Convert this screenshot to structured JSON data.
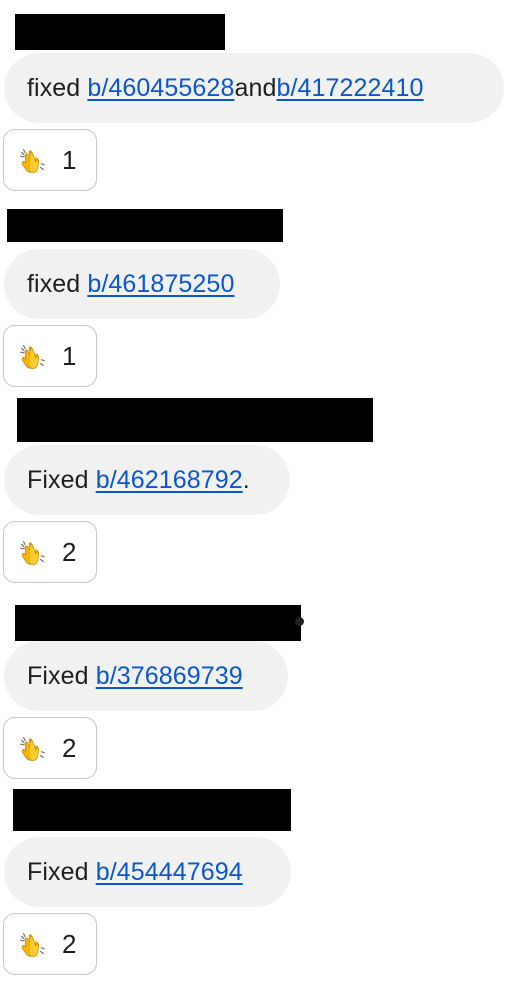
{
  "messages": [
    {
      "prefix": "fixed ",
      "links": [
        "b/460455628",
        "b/417222410"
      ],
      "joiner": " and ",
      "suffix": "",
      "reaction": {
        "icon": "clapping-hands-icon",
        "count": "1"
      }
    },
    {
      "prefix": "fixed ",
      "links": [
        "b/461875250"
      ],
      "joiner": "",
      "suffix": "",
      "reaction": {
        "icon": "clapping-hands-icon",
        "count": "1"
      }
    },
    {
      "prefix": "Fixed ",
      "links": [
        "b/462168792"
      ],
      "joiner": "",
      "suffix": ".",
      "reaction": {
        "icon": "clapping-hands-icon",
        "count": "2"
      }
    },
    {
      "prefix": "Fixed ",
      "links": [
        "b/376869739"
      ],
      "joiner": "",
      "suffix": "",
      "reaction": {
        "icon": "clapping-hands-icon",
        "count": "2"
      }
    },
    {
      "prefix": "Fixed ",
      "links": [
        "b/454447694"
      ],
      "joiner": "",
      "suffix": "",
      "reaction": {
        "icon": "clapping-hands-icon",
        "count": "2"
      }
    }
  ],
  "colors": {
    "bubble_bg": "#f1f1f1",
    "link": "#0b57d0",
    "redaction": "#000000",
    "reaction_border": "#c7c7c7"
  }
}
